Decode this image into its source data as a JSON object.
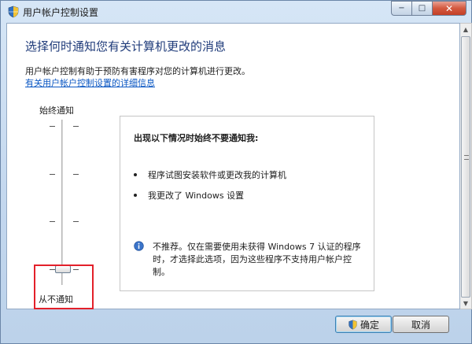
{
  "window": {
    "title": "用户帐户控制设置",
    "min_label": "−",
    "max_label": "□",
    "close_label": "✕"
  },
  "main": {
    "heading": "选择何时通知您有关计算机更改的消息",
    "description": "用户帐户控制有助于预防有害程序对您的计算机进行更改。",
    "link": "有关用户帐户控制设置的详细信息"
  },
  "slider": {
    "top_label": "始终通知",
    "bottom_label": "从不通知",
    "level_fraction": 0.0,
    "levels": 4,
    "selected_level": 0
  },
  "info": {
    "title": "出现以下情况时始终不要通知我:",
    "bullets": [
      "程序试图安装软件或更改我的计算机",
      "我更改了 Windows 设置"
    ],
    "notice": "不推荐。仅在需要使用未获得 Windows 7 认证的程序时，才选择此选项，因为这些程序不支持用户帐户控制。"
  },
  "buttons": {
    "ok": "确定",
    "cancel": "取消"
  },
  "colors": {
    "heading": "#1f3b7a",
    "link": "#0b57c3",
    "highlight_box": "#e3202a"
  }
}
